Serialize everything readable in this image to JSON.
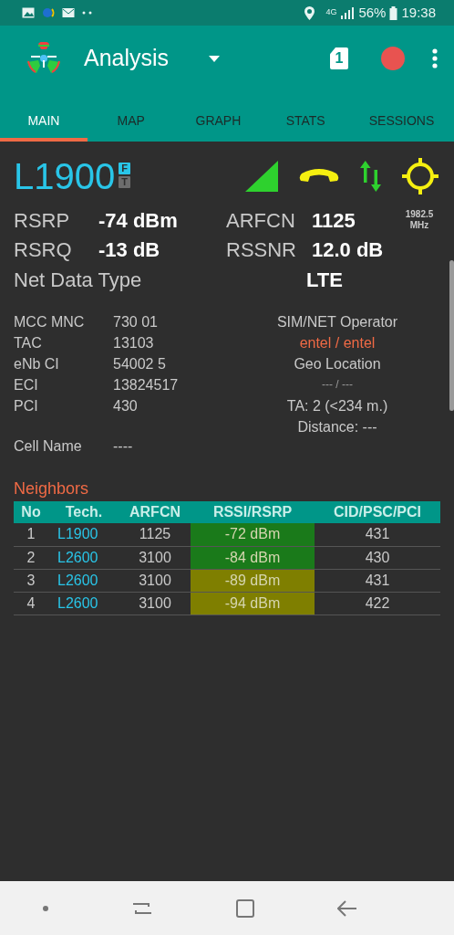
{
  "status_bar": {
    "network": "4G",
    "battery": "56%",
    "time": "19:38"
  },
  "app_bar": {
    "title": "Analysis",
    "sim": "1"
  },
  "tabs": [
    {
      "label": "MAIN",
      "selected": true
    },
    {
      "label": "MAP",
      "selected": false
    },
    {
      "label": "GRAPH",
      "selected": false
    },
    {
      "label": "STATS",
      "selected": false
    },
    {
      "label": "SESSIONS",
      "selected": false
    }
  ],
  "cell": {
    "band": "L1900",
    "badges": [
      {
        "label": "F",
        "on": true
      },
      {
        "label": "T",
        "on": false
      }
    ]
  },
  "metrics": [
    {
      "label": "RSRP",
      "value": "-74 dBm",
      "label2": "ARFCN",
      "value2": "1125",
      "note": "1982.5 MHz"
    },
    {
      "label": "RSRQ",
      "value": "-13 dB",
      "label2": "RSSNR",
      "value2": "12.0 dB"
    }
  ],
  "net_data_type": {
    "label": "Net Data Type",
    "value": "LTE"
  },
  "ids": [
    {
      "label": "MCC MNC",
      "value": "730 01"
    },
    {
      "label": "TAC",
      "value": "13103"
    },
    {
      "label": "eNb CI",
      "value": "54002 5"
    },
    {
      "label": "ECI",
      "value": "13824517"
    },
    {
      "label": "PCI",
      "value": "430"
    }
  ],
  "location": [
    {
      "kind": "heading",
      "text": "SIM/NET Operator"
    },
    {
      "kind": "highlight",
      "text": "entel / entel"
    },
    {
      "kind": "heading",
      "text": "Geo Location"
    },
    {
      "kind": "faint",
      "text": "--- / ---"
    },
    {
      "kind": "heading",
      "text": "TA: 2 (<234 m.)"
    },
    {
      "kind": "heading",
      "text": "Distance: ---"
    }
  ],
  "cell_name": {
    "label": "Cell Name",
    "value": "----"
  },
  "neighbors": {
    "title": "Neighbors",
    "columns": [
      "No",
      "Tech.",
      "ARFCN",
      "RSSI/RSRP",
      "CID/PSC/PCI"
    ],
    "rows": [
      {
        "no": "1",
        "tech": "L1900",
        "arfcn": "1125",
        "signal": "-72 dBm",
        "color": "#1a7a1a",
        "id": "431"
      },
      {
        "no": "2",
        "tech": "L2600",
        "arfcn": "3100",
        "signal": "-84 dBm",
        "color": "#1a7a1a",
        "id": "430"
      },
      {
        "no": "3",
        "tech": "L2600",
        "arfcn": "3100",
        "signal": "-89 dBm",
        "color": "#7f7f00",
        "id": "431"
      },
      {
        "no": "4",
        "tech": "L2600",
        "arfcn": "3100",
        "signal": "-94 dBm",
        "color": "#7f7f00",
        "id": "422"
      }
    ]
  }
}
